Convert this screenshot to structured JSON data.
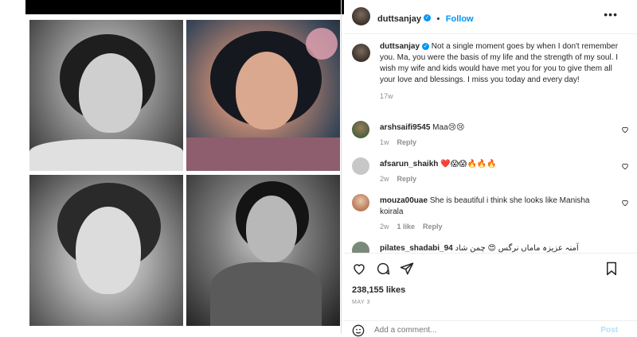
{
  "post": {
    "author": "duttsanjay",
    "follow_label": "Follow",
    "more_label": "•••",
    "caption": "Not a single moment goes by when I don't remember you. Ma, you were the basis of my life and the strength of my soul. I wish my wife and kids would have met you for you to give them all your love and blessings. I miss you today and every day!",
    "caption_age": "17w",
    "likes": "238,155 likes",
    "date": "MAY 3"
  },
  "comments": [
    {
      "user": "arshsaifi9545",
      "text": "Maa😢😢",
      "age": "1w",
      "likes": "",
      "reply": "Reply"
    },
    {
      "user": "afsarun_shaikh",
      "text": "❤️😱😱🔥🔥🔥",
      "age": "2w",
      "likes": "",
      "reply": "Reply"
    },
    {
      "user": "mouza00uae",
      "text": "She is beautiful i think she looks like Manisha koirala",
      "age": "2w",
      "likes": "1 like",
      "reply": "Reply"
    },
    {
      "user": "pilates_shadabi_94",
      "text": "آمنہ عزیزہ ماماں نرگس 😍 چمن شاد",
      "age": "",
      "likes": "",
      "reply": ""
    }
  ],
  "add_comment": {
    "placeholder": "Add a comment...",
    "post_label": "Post"
  },
  "colors": {
    "accent": "#0095f6",
    "verified": "#0095f6",
    "muted": "#8e8e8e"
  },
  "icons": [
    "heart-icon",
    "comment-icon",
    "share-icon",
    "bookmark-icon",
    "emoji-icon",
    "more-icon",
    "verified-badge-icon"
  ]
}
